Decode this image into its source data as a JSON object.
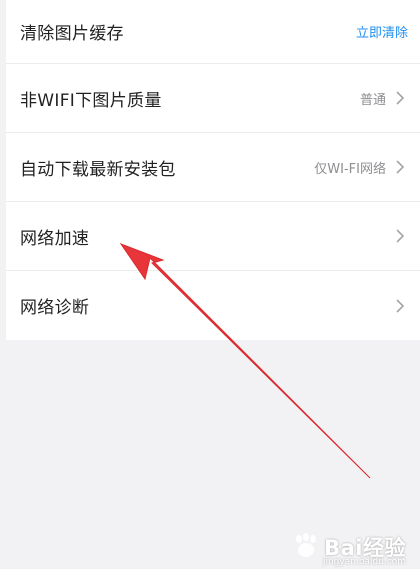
{
  "settings": {
    "items": [
      {
        "label": "清除图片缓存",
        "value": "",
        "action": "立即清除"
      },
      {
        "label": "非WIFI下图片质量",
        "value": "普通",
        "action": ""
      },
      {
        "label": "自动下载最新安装包",
        "value": "仅WI-FI网络",
        "action": ""
      },
      {
        "label": "网络加速",
        "value": "",
        "action": ""
      },
      {
        "label": "网络诊断",
        "value": "",
        "action": ""
      }
    ]
  },
  "watermark": {
    "brand": "Bai",
    "brand_suffix": "经验",
    "url": "jingyan.baidu.com"
  },
  "colors": {
    "background": "#f2f2f4",
    "card": "#ffffff",
    "accent": "#1f8ef1",
    "annotation": "#e8353a"
  }
}
